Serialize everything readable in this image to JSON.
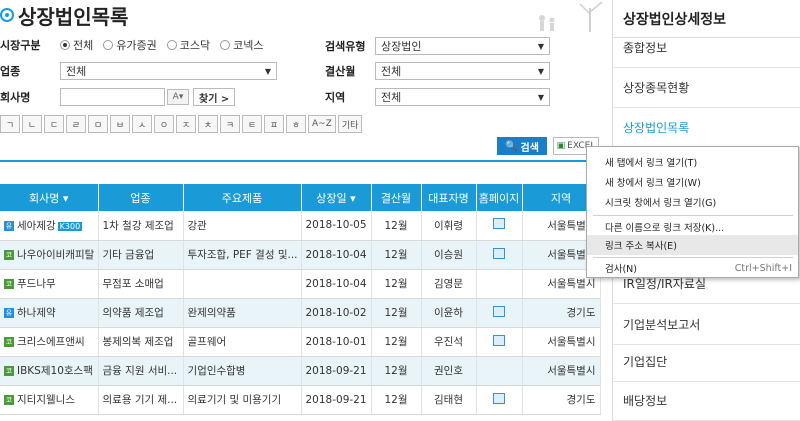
{
  "page_title": "상장법인목록",
  "filters": {
    "market_label": "시장구분",
    "market_options": [
      "전체",
      "유가증권",
      "코스닥",
      "코넥스"
    ],
    "industry_label": "업종",
    "industry_value": "전체",
    "company_label": "회사명",
    "a_button": "A",
    "find_button": "찾기 >",
    "search_type_label": "검색유형",
    "search_type_value": "상장법인",
    "settlement_label": "결산월",
    "settlement_value": "전체",
    "region_label": "지역",
    "region_value": "전체"
  },
  "consonants": [
    "ㄱ",
    "ㄴ",
    "ㄷ",
    "ㄹ",
    "ㅁ",
    "ㅂ",
    "ㅅ",
    "ㅇ",
    "ㅈ",
    "ㅊ",
    "ㅋ",
    "ㅌ",
    "ㅍ",
    "ㅎ",
    "A~Z",
    "기타"
  ],
  "buttons": {
    "search": "검색",
    "excel": "EXCEL"
  },
  "table": {
    "headers": [
      "회사명 ▾",
      "업종",
      "주요제품",
      "상장일 ▾",
      "결산월",
      "대표자명",
      "홈페이지",
      "지역"
    ],
    "rows": [
      {
        "name": "세아제강",
        "badge": "K300",
        "industry": "1차 철강 제조업",
        "product": "강관",
        "date": "2018-10-05",
        "month": "12월",
        "ceo": "이휘령",
        "region": "서울특별시"
      },
      {
        "name": "나우아이비캐피탈",
        "badge": "",
        "industry": "기타 금융업",
        "product": "투자조합, PEF 결성 및...",
        "date": "2018-10-04",
        "month": "12월",
        "ceo": "이승원",
        "region": "서울특별시"
      },
      {
        "name": "푸드나무",
        "badge": "",
        "industry": "무점포 소매업",
        "product": "",
        "date": "2018-10-04",
        "month": "12월",
        "ceo": "김영문",
        "region": "서울특별시"
      },
      {
        "name": "하나제약",
        "badge": "",
        "industry": "의약품 제조업",
        "product": "완제의약품",
        "date": "2018-10-02",
        "month": "12월",
        "ceo": "이윤하",
        "region": "경기도"
      },
      {
        "name": "크리스에프앤씨",
        "badge": "",
        "industry": "봉제의복 제조업",
        "product": "골프웨어",
        "date": "2018-10-01",
        "month": "12월",
        "ceo": "우진석",
        "region": "서울특별시"
      },
      {
        "name": "IBKS제10호스팩",
        "badge": "",
        "industry": "금융 지원 서비...",
        "product": "기업인수합병",
        "date": "2018-09-21",
        "month": "12월",
        "ceo": "권인호",
        "region": "서울특별시"
      },
      {
        "name": "지티지웰니스",
        "badge": "",
        "industry": "의료용 기기 제...",
        "product": "의료기기 및 미용기기",
        "date": "2018-09-21",
        "month": "12월",
        "ceo": "김태현",
        "region": "경기도"
      }
    ]
  },
  "sidebar": {
    "title": "상장법인상세정보",
    "items": [
      "종합정보",
      "상장종목현황",
      "상장법인목록",
      "IR일정/IR자료실",
      "기업분석보고서",
      "기업집단",
      "배당정보"
    ]
  },
  "context_menu": {
    "items": [
      {
        "label": "새 탭에서 링크 열기(T)",
        "shortcut": ""
      },
      {
        "label": "새 창에서 링크 열기(W)",
        "shortcut": ""
      },
      {
        "label": "시크릿 창에서 링크 열기(G)",
        "shortcut": ""
      },
      {
        "label": "다른 이름으로 링크 저장(K)...",
        "shortcut": ""
      },
      {
        "label": "링크 주소 복사(E)",
        "shortcut": ""
      },
      {
        "label": "검사(N)",
        "shortcut": "Ctrl+Shift+I"
      }
    ]
  },
  "colors": {
    "accent": "#1a9bd7",
    "header_bg": "#1a9bd7",
    "alt_row": "#e9f4f9"
  }
}
